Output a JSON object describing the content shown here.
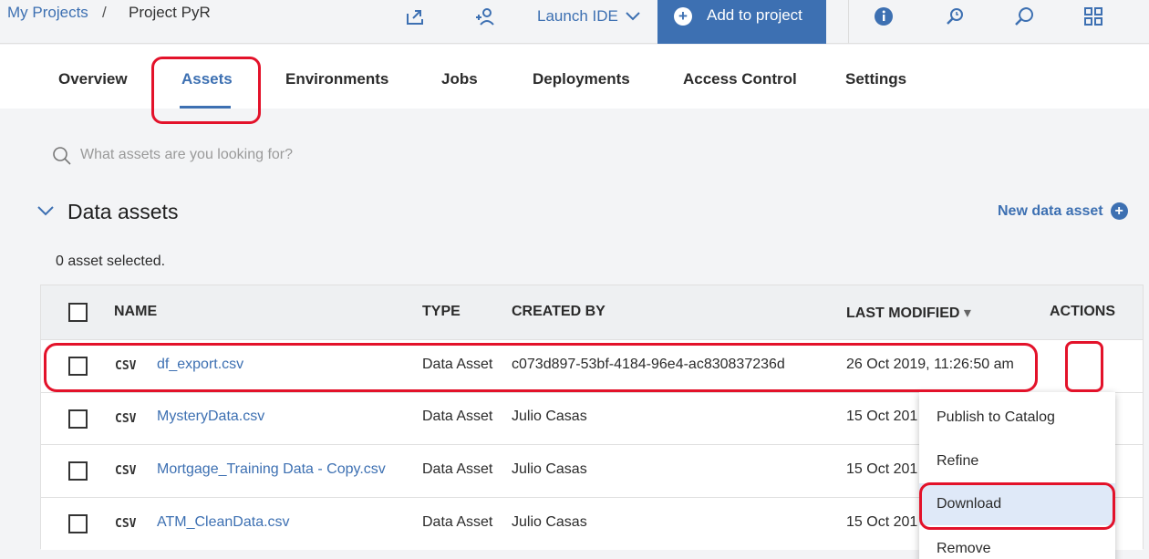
{
  "breadcrumb": {
    "projects": "My Projects",
    "separator": "/",
    "current": "Project PyR"
  },
  "header": {
    "launch_ide": "Launch IDE",
    "add_to_project": "Add to project",
    "icons": [
      "share-icon",
      "add-collaborator-icon",
      "chevron-down-icon",
      "info-icon",
      "history-icon",
      "community-icon",
      "apps-icon"
    ]
  },
  "tabs": [
    "Overview",
    "Assets",
    "Environments",
    "Jobs",
    "Deployments",
    "Access Control",
    "Settings"
  ],
  "active_tab": "Assets",
  "search": {
    "placeholder": "What assets are you looking for?"
  },
  "section": {
    "title": "Data assets",
    "new_link": "New data asset",
    "selected_text": "0 asset selected."
  },
  "table": {
    "headers": {
      "name": "NAME",
      "type": "TYPE",
      "created_by": "CREATED BY",
      "last_modified": "LAST MODIFIED",
      "actions": "ACTIONS"
    },
    "sort_indicator": "▾",
    "rows": [
      {
        "badge": "CSV",
        "name": "df_export.csv",
        "type": "Data Asset",
        "created_by": "c073d897-53bf-4184-96e4-ac830837236d",
        "last_modified": "26 Oct 2019, 11:26:50 am"
      },
      {
        "badge": "CSV",
        "name": "MysteryData.csv",
        "type": "Data Asset",
        "created_by": "Julio Casas",
        "last_modified": "15 Oct 201"
      },
      {
        "badge": "CSV",
        "name": "Mortgage_Training Data - Copy.csv",
        "type": "Data Asset",
        "created_by": "Julio Casas",
        "last_modified": "15 Oct 201"
      },
      {
        "badge": "CSV",
        "name": "ATM_CleanData.csv",
        "type": "Data Asset",
        "created_by": "Julio Casas",
        "last_modified": "15 Oct 201"
      }
    ]
  },
  "menu": {
    "items": [
      "Publish to Catalog",
      "Refine",
      "Download",
      "Remove"
    ],
    "highlighted": "Download"
  },
  "colors": {
    "accent": "#3d70b2",
    "annotation": "#e3122a",
    "menu_highlight": "#dfe9f8"
  }
}
